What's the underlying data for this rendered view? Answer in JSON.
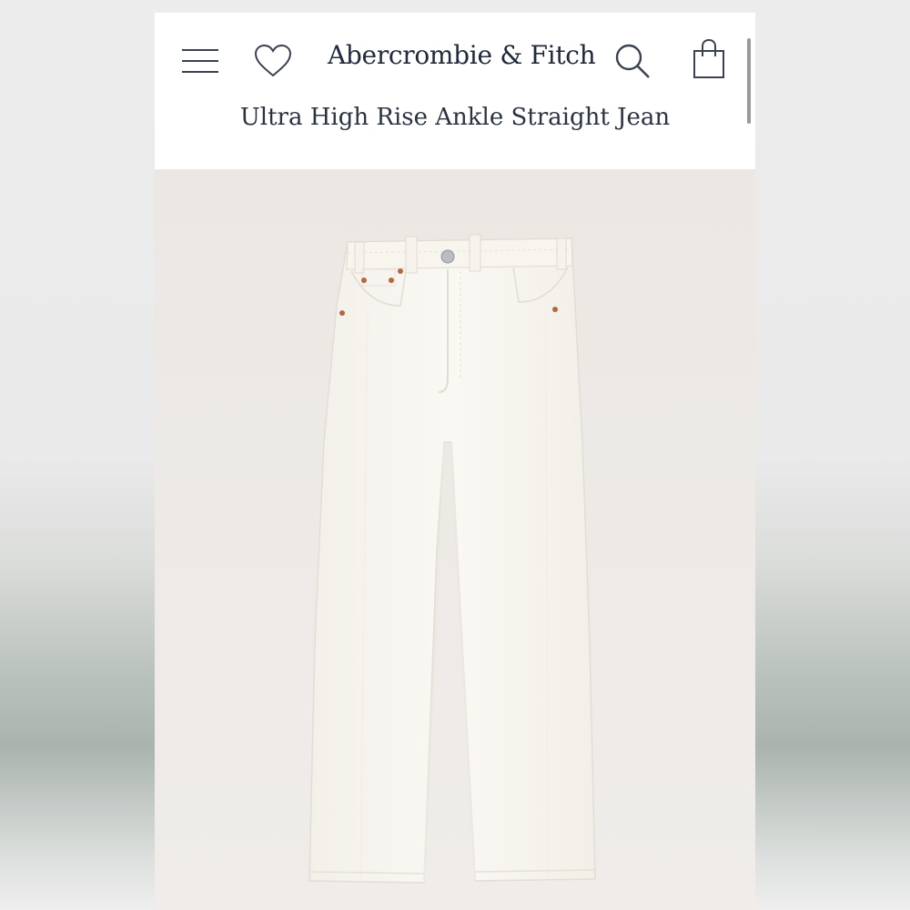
{
  "header": {
    "brand": "Abercrombie & Fitch",
    "product_title": "Ultra High Rise Ankle Straight Jean",
    "icons": {
      "menu": "menu-icon",
      "wishlist": "heart-icon",
      "search": "search-icon",
      "bag": "shopping-bag-icon"
    }
  },
  "product": {
    "image_subject": "white high rise straight jeans"
  },
  "colors": {
    "text": "#1f2a3a",
    "background": "#eeebe8",
    "denim": "#f7f4ee",
    "rivet": "#b5673f"
  }
}
